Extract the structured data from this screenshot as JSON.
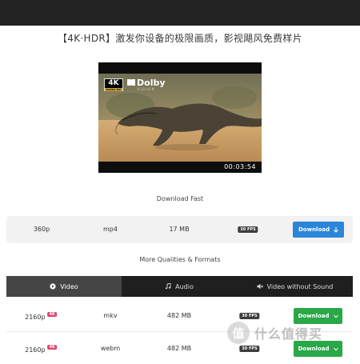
{
  "headline": "【4K·HDR】激发你设备的极限画质，影视飓风免费样片",
  "video": {
    "badge_main": "4K",
    "badge_sub": "ULTRA HD",
    "dolby_label": "Dolby",
    "dolby_sub": "VISION",
    "duration": "00:03:54"
  },
  "download_fast": {
    "label": "Download Fast",
    "row": {
      "resolution": "360p",
      "format": "mp4",
      "size": "17 MB",
      "fps": "30 FPS",
      "button_label": "Download",
      "button_icon": "arrow-down-icon"
    }
  },
  "more_qualities": {
    "label": "More Qualities & Formats",
    "tabs": [
      {
        "label": "Video",
        "icon": "play-circle-icon",
        "active": true
      },
      {
        "label": "Audio",
        "icon": "music-note-icon",
        "active": false
      },
      {
        "label": "Video without Sound",
        "icon": "mute-icon",
        "active": false
      }
    ],
    "rows": [
      {
        "resolution": "2160p",
        "badge": "4K",
        "format": "mkv",
        "size": "482 MB",
        "fps": "30 FPS",
        "button_label": "Download",
        "button_icon": "chevron-down-icon"
      },
      {
        "resolution": "2160p",
        "badge": "4K",
        "format": "webm",
        "size": "482 MB",
        "fps": "30 FPS",
        "button_label": "Download",
        "button_icon": "chevron-down-icon"
      }
    ]
  },
  "watermark": {
    "mark": "值",
    "text": "什么值得买"
  },
  "colors": {
    "topbar": "#222222",
    "blue_button": "#2b86d8",
    "green_button": "#2aa748",
    "tab_bar": "#1f1f1f",
    "tab_active": "#454545",
    "badge_4k": "#e0406d"
  }
}
